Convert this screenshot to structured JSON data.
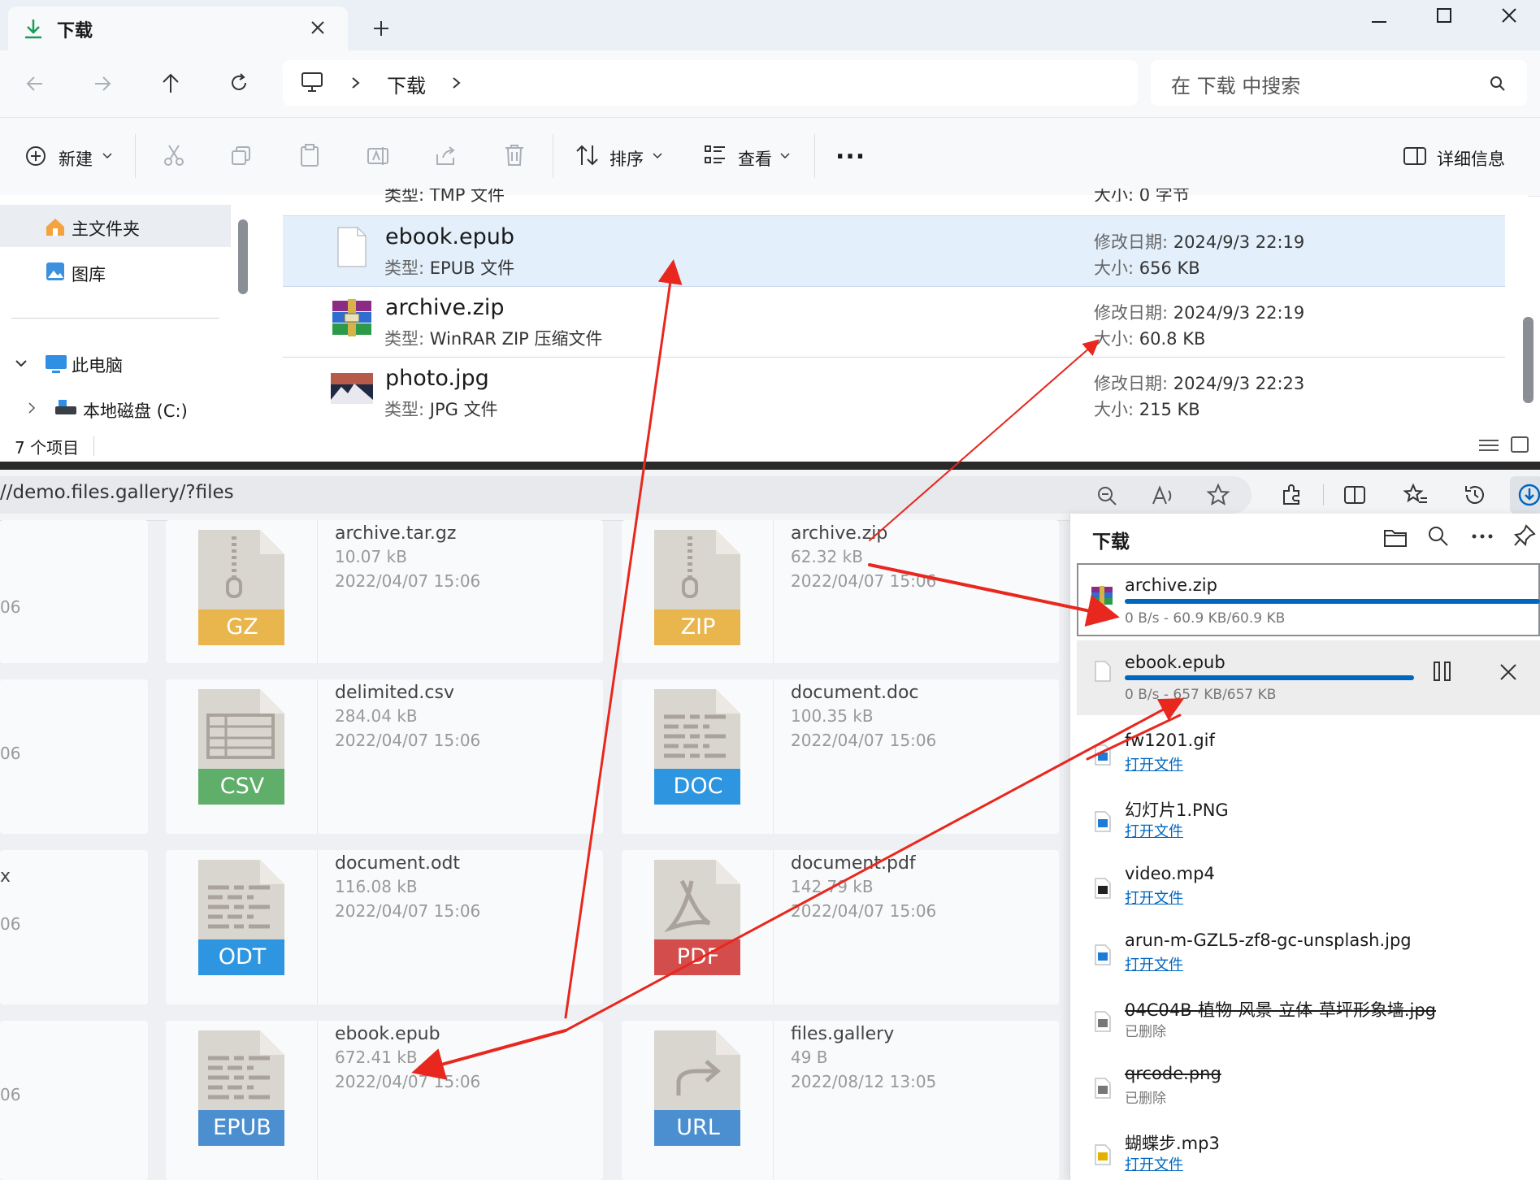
{
  "colors": {
    "accent": "#0067c0",
    "selected_row": "#e3effb",
    "arrow": "#e8271e",
    "gz": "#e9b54d",
    "zip": "#e9b54d",
    "csv": "#5fae6a",
    "doc": "#2e96e0",
    "odt": "#2e96e0",
    "pdf": "#d44d4d",
    "epub": "#4b8fd1",
    "url": "#4b8fd1"
  },
  "explorer": {
    "tab_title": "下载",
    "breadcrumb": "下载",
    "search_placeholder": "在 下载 中搜索",
    "toolbar": {
      "new": "新建",
      "sort": "排序",
      "view": "查看",
      "more": "...",
      "details": "详细信息"
    },
    "nav": {
      "home": "主文件夹",
      "gallery": "图库",
      "this_pc": "此电脑",
      "local_disk": "本地磁盘 (C:)"
    },
    "partial_row": {
      "type": "类型: TMP 文件",
      "size": "大小: 0 字节"
    },
    "files": [
      {
        "name": "ebook.epub",
        "type_label": "类型:",
        "type": "EPUB 文件",
        "date_label": "修改日期:",
        "date": "2024/9/3 22:19",
        "size_label": "大小:",
        "size": "656 KB"
      },
      {
        "name": "archive.zip",
        "type_label": "类型:",
        "type": "WinRAR ZIP 压缩文件",
        "date_label": "修改日期:",
        "date": "2024/9/3 22:19",
        "size_label": "大小:",
        "size": "60.8 KB"
      },
      {
        "name": "photo.jpg",
        "type_label": "类型:",
        "type": "JPG 文件",
        "date_label": "修改日期:",
        "date": "2024/9/3 22:23",
        "size_label": "大小:",
        "size": "215 KB"
      }
    ],
    "status": "7 个项目"
  },
  "browser": {
    "url": "//demo.files.gallery/?files",
    "left_col": [
      "06",
      "06",
      "x",
      "06",
      "06"
    ],
    "cards": [
      {
        "name": "archive.tar.gz",
        "size": "10.07 kB",
        "date": "2022/04/07 15:06",
        "ext": "GZ"
      },
      {
        "name": "archive.zip",
        "size": "62.32 kB",
        "date": "2022/04/07 15:06",
        "ext": "ZIP"
      },
      {
        "name": "delimited.csv",
        "size": "284.04 kB",
        "date": "2022/04/07 15:06",
        "ext": "CSV"
      },
      {
        "name": "document.doc",
        "size": "100.35 kB",
        "date": "2022/04/07 15:06",
        "ext": "DOC"
      },
      {
        "name": "document.odt",
        "size": "116.08 kB",
        "date": "2022/04/07 15:06",
        "ext": "ODT"
      },
      {
        "name": "document.pdf",
        "size": "142.79 kB",
        "date": "2022/04/07 15:06",
        "ext": "PDF"
      },
      {
        "name": "ebook.epub",
        "size": "672.41 kB",
        "date": "2022/04/07 15:06",
        "ext": "EPUB"
      },
      {
        "name": "files.gallery",
        "size": "49 B",
        "date": "2022/08/12 13:05",
        "ext": "URL"
      }
    ]
  },
  "downloads": {
    "title": "下载",
    "active": [
      {
        "name": "archive.zip",
        "status": "0 B/s - 60.9 KB/60.9 KB",
        "progress": 1.0
      },
      {
        "name": "ebook.epub",
        "status": "0 B/s - 657 KB/657 KB",
        "progress": 1.0
      }
    ],
    "items": [
      {
        "name": "fw1201.gif",
        "action": "打开文件"
      },
      {
        "name": "幻灯片1.PNG",
        "action": "打开文件"
      },
      {
        "name": "video.mp4",
        "action": "打开文件"
      },
      {
        "name": "arun-m-GZL5-zf8-gc-unsplash.jpg",
        "action": "打开文件"
      },
      {
        "name": "04C04B-植物-风景-立体-草坪形象墙.jpg",
        "action": "已删除"
      },
      {
        "name": "qrcode.png",
        "action": "已删除"
      },
      {
        "name": "蝴蝶步.mp3",
        "action": "打开文件"
      }
    ]
  }
}
